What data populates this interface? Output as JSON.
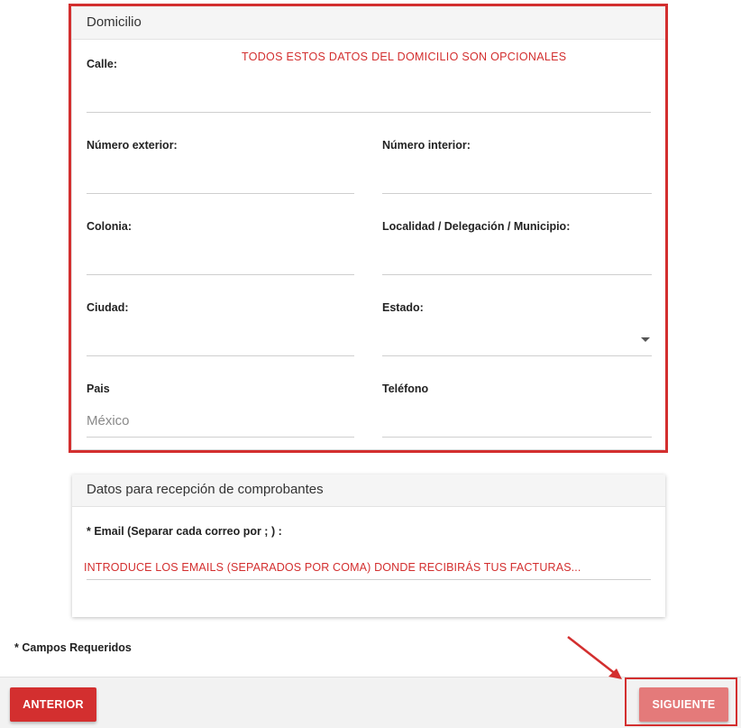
{
  "domicilio": {
    "title": "Domicilio",
    "note": "TODOS ESTOS DATOS DEL DOMICILIO SON OPCIONALES",
    "calle_label": "Calle:",
    "num_ext_label": "Número exterior:",
    "num_int_label": "Número interior:",
    "colonia_label": "Colonia:",
    "localidad_label": "Localidad / Delegación / Municipio:",
    "ciudad_label": "Ciudad:",
    "estado_label": "Estado:",
    "pais_label": "Pais",
    "pais_value": "México",
    "telefono_label": "Teléfono"
  },
  "recepcion": {
    "title": "Datos para recepción de comprobantes",
    "email_label": "* Email (Separar cada correo por ; ) :",
    "email_note": "INTRODUCE LOS EMAILS (SEPARADOS POR COMA) DONDE RECIBIRÁS TUS FACTURAS..."
  },
  "required_note": "* Campos Requeridos",
  "buttons": {
    "prev": "ANTERIOR",
    "next": "SIGUIENTE"
  },
  "colors": {
    "accent_red": "#d32f2f",
    "disabled_red": "#e47a7a"
  }
}
